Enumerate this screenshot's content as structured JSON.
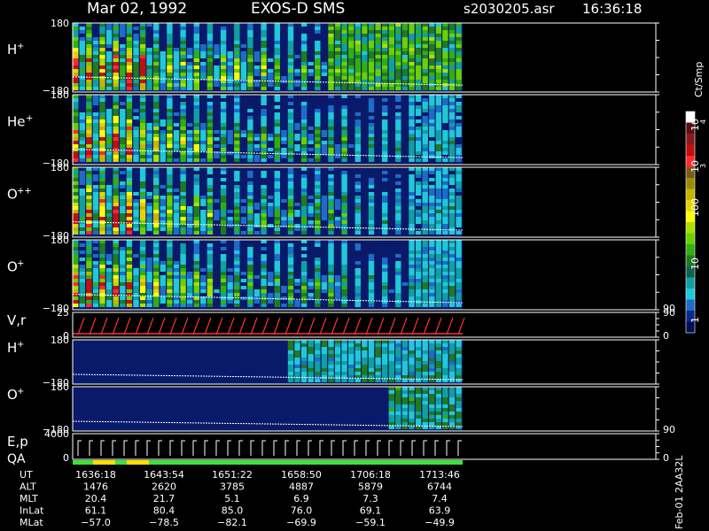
{
  "header": {
    "date": "Mar 02, 1992",
    "instrument": "EXOS-D SMS",
    "file": "s2030205.asr",
    "time": "16:36:18"
  },
  "panels": [
    {
      "id": "h-plus",
      "label": "H",
      "sup": "+",
      "y_top": "180",
      "y_bottom": "−180"
    },
    {
      "id": "he-plus",
      "label": "He",
      "sup": "+",
      "y_top": "180",
      "y_bottom": "−180"
    },
    {
      "id": "o-plusplus",
      "label": "O",
      "sup": "++",
      "y_top": "180",
      "y_bottom": "−180"
    },
    {
      "id": "o-plus",
      "label": "O",
      "sup": "+",
      "y_top": "180",
      "y_bottom": "−180",
      "right_tick": "90"
    },
    {
      "id": "vr",
      "label": "V,r",
      "sup": "",
      "y_top": "25",
      "y_bottom": "0",
      "right_top": "90",
      "right_bottom": "0"
    },
    {
      "id": "h-plus-2",
      "label": "H",
      "sup": "+",
      "y_top": "180",
      "y_bottom": "−180"
    },
    {
      "id": "o-plus-2",
      "label": "O",
      "sup": "+",
      "y_top": "180",
      "y_bottom": "−180",
      "right_bottom": "90"
    },
    {
      "id": "ep-qa",
      "label": "E,p",
      "label2": "QA",
      "sup": "",
      "y_top": "4000",
      "y_bottom": "0",
      "right_bottom": "0"
    }
  ],
  "colorbar": {
    "unit": "Ct/Smp",
    "ticks": [
      "10",
      "4",
      "10",
      "3",
      "100",
      "10",
      "1"
    ],
    "colors": [
      "#ffffff",
      "#5a1010",
      "#8a1a1a",
      "#c01010",
      "#ff2a2a",
      "#7a5a18",
      "#9a8a10",
      "#c8b400",
      "#e6d400",
      "#ffff00",
      "#a8e000",
      "#6ad000",
      "#30b010",
      "#207a20",
      "#106050",
      "#10a0a0",
      "#20c8d8",
      "#1e6cc8",
      "#0a2a8a",
      "#00105a"
    ]
  },
  "footer": {
    "rows": [
      {
        "label": "UT",
        "values": [
          "1636:18",
          "1643:54",
          "1651:22",
          "1658:50",
          "1706:18",
          "1713:46"
        ]
      },
      {
        "label": "ALT",
        "values": [
          "1476",
          "2620",
          "3785",
          "4887",
          "5879",
          "6744"
        ]
      },
      {
        "label": "MLT",
        "values": [
          "20.4",
          "21.7",
          "5.1",
          "6.9",
          "7.3",
          "7.4"
        ]
      },
      {
        "label": "InLat",
        "values": [
          "61.1",
          "80.4",
          "85.0",
          "76.0",
          "69.1",
          "63.9"
        ]
      },
      {
        "label": "MLat",
        "values": [
          "−57.0",
          "−78.5",
          "−82.1",
          "−69.9",
          "−59.1",
          "−49.9"
        ]
      }
    ],
    "stamp": "Feb-01 2AA32L"
  },
  "chart_data": {
    "type": "heatmap",
    "title": "Mar 02, 1992   EXOS-D SMS",
    "x_time_labels": [
      "1636:18",
      "1643:54",
      "1651:22",
      "1658:50",
      "1706:18",
      "1713:46"
    ],
    "panels": [
      "H+",
      "He+",
      "O++",
      "O+",
      "V,r",
      "H+",
      "O+",
      "E,p QA"
    ],
    "pitch_angle_range": [
      -180,
      180
    ],
    "colorbar_unit": "Ct/Smp",
    "colorbar_range": [
      "1",
      "10^4"
    ]
  }
}
